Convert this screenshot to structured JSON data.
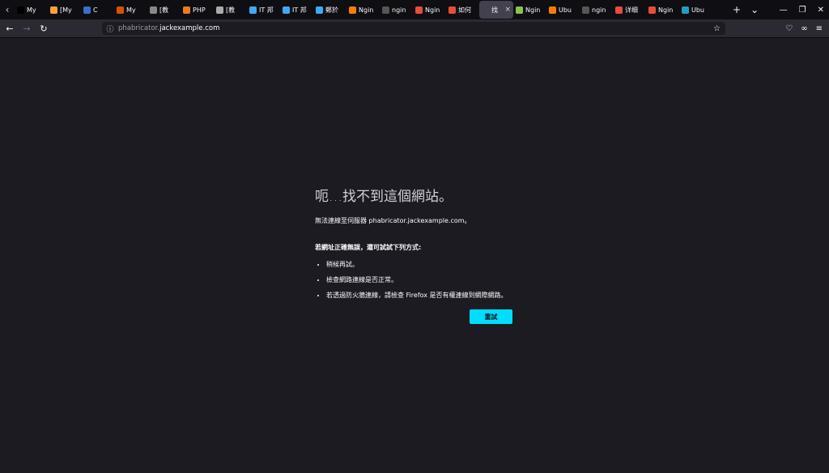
{
  "tabs": [
    {
      "label": "My",
      "color": "#000000",
      "icon": "bracket-icon"
    },
    {
      "label": "[My",
      "color": "#f6a23a",
      "icon": "edit-icon"
    },
    {
      "label": "C",
      "color": "#3a6fc4",
      "icon": "gear-icon"
    },
    {
      "label": "My",
      "color": "#d35400",
      "icon": "mysql-icon"
    },
    {
      "label": "[教",
      "color": "#888888",
      "icon": "user-icon"
    },
    {
      "label": "PHP",
      "color": "#e67e22",
      "icon": "php-icon"
    },
    {
      "label": "[教",
      "color": "#aaaaaa",
      "icon": "doc-icon"
    },
    {
      "label": "IT 邦",
      "color": "#3fa9f5",
      "icon": "ithome-icon"
    },
    {
      "label": "IT 邦",
      "color": "#3fa9f5",
      "icon": "ithome-icon"
    },
    {
      "label": "鄭於",
      "color": "#3fa9f5",
      "icon": "blog-icon"
    },
    {
      "label": "Ngin",
      "color": "#f57d00",
      "icon": "blogger-icon"
    },
    {
      "label": "ngin",
      "color": "#555555",
      "icon": "google-icon"
    },
    {
      "label": "Ngin",
      "color": "#e74c3c",
      "icon": "csdn-icon"
    },
    {
      "label": "如何",
      "color": "#e74c3c",
      "icon": "csdn-icon"
    },
    {
      "label": "找",
      "color": "#42414d",
      "icon": "info-icon",
      "active": true
    },
    {
      "label": "Ngin",
      "color": "#8bc34a",
      "icon": "android-icon"
    },
    {
      "label": "Ubu",
      "color": "#f57d00",
      "icon": "blogger-icon"
    },
    {
      "label": "ngin",
      "color": "#555555",
      "icon": "google-icon"
    },
    {
      "label": "详细",
      "color": "#e74c3c",
      "icon": "csdn-icon"
    },
    {
      "label": "Ngin",
      "color": "#e74c3c",
      "icon": "csdn-icon"
    },
    {
      "label": "Ubu",
      "color": "#20a0c0",
      "icon": "ubuntu-icon"
    }
  ],
  "url": {
    "prefix": "phabricator.",
    "host": "jackexample.com"
  },
  "error": {
    "title": "呃…找不到這個網站。",
    "description": "無法連線至伺服器 phabricator.jackexample.com。",
    "subheading": "若網址正確無誤，還可試試下列方式:",
    "suggestions": [
      "稍候再試。",
      "檢查網路連線是否正常。",
      "若透過防火牆連線，請檢查 Firefox 是否有權連線到網際網路。"
    ],
    "retry_label": "重試"
  },
  "colors": {
    "accent": "#00ddff",
    "page_bg": "#1c1b22",
    "tabbar_bg": "#0f0e13"
  }
}
